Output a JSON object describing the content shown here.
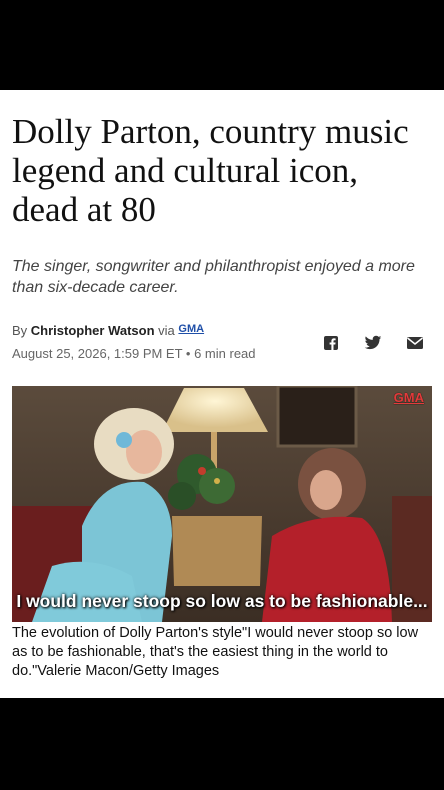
{
  "article": {
    "headline": "Dolly Parton, country music legend and cultural icon, dead at 80",
    "dek": "The singer, songwriter and philanthropist enjoyed a more than six-decade career.",
    "byline_prefix": "By",
    "author": "Christopher Watson",
    "via": "via",
    "source_logo": "GMA",
    "date": "August 25, 2026, 1:59 PM ET • 6 min read"
  },
  "share": {
    "icons": [
      "facebook-icon",
      "twitter-icon",
      "email-icon"
    ]
  },
  "media": {
    "overlay_text": "I would never stoop so low as to be fashionable...",
    "badge": "GMA",
    "caption": "The evolution of Dolly Parton's style\"I would never stoop so low as to be fashionable, that's the easiest thing in the world to do.\"Valerie Macon/Getty Images"
  },
  "colors": {
    "link_blue": "#1f4fa8",
    "badge_red": "#e23b3b",
    "text_dark": "#111111"
  }
}
